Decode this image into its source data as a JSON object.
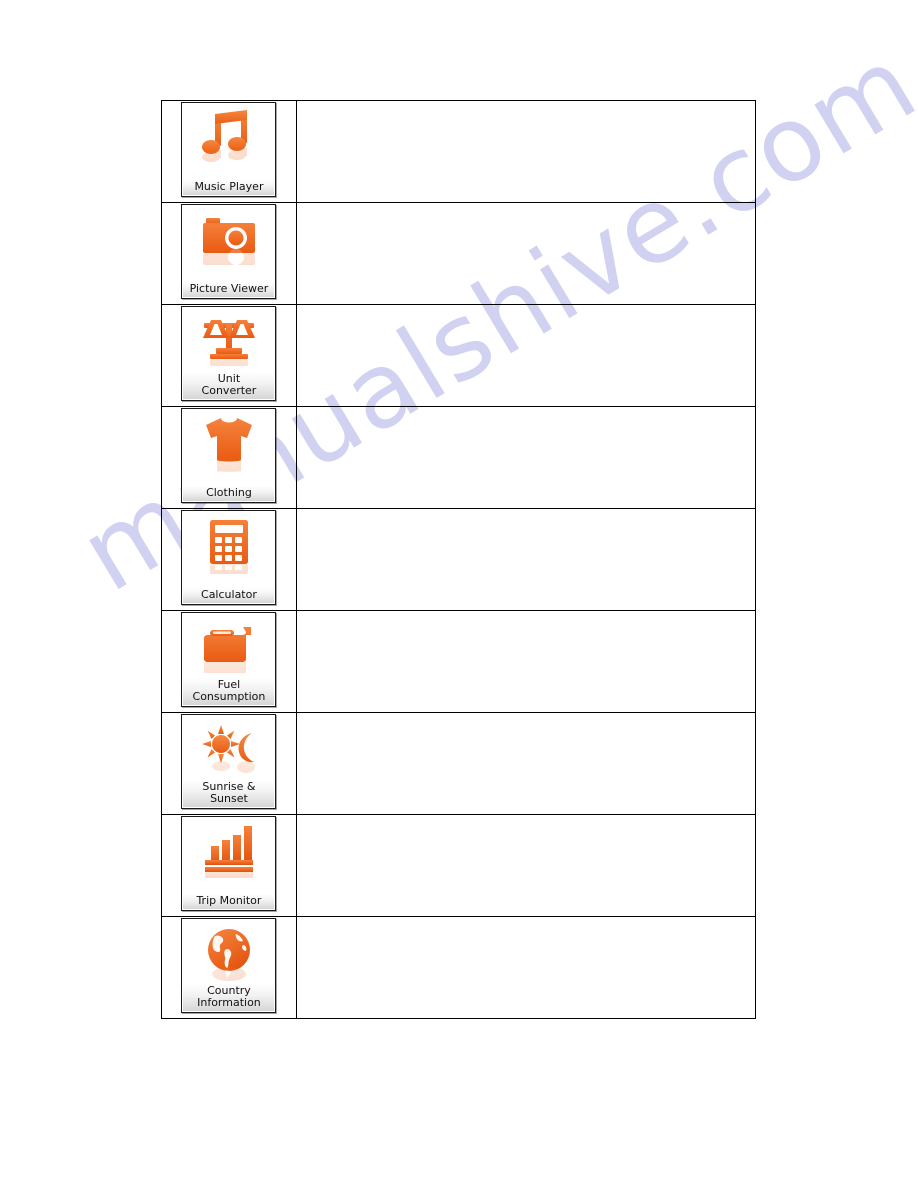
{
  "page": {
    "background_color": "#ffffff",
    "watermark_text": "manualshive.com",
    "watermark_color": "#c9c9ef"
  },
  "table": {
    "border_color": "#000000",
    "columns": [
      "icon",
      "description"
    ],
    "rows": [
      {
        "icon_name": "music-note-icon",
        "label": "Music Player",
        "label_lines": [
          "Music Player"
        ],
        "description": ""
      },
      {
        "icon_name": "camera-icon",
        "label": "Picture Viewer",
        "label_lines": [
          "Picture Viewer"
        ],
        "description": ""
      },
      {
        "icon_name": "balance-scale-icon",
        "label": "Unit Converter",
        "label_lines": [
          "Unit",
          "Converter"
        ],
        "description": ""
      },
      {
        "icon_name": "tshirt-icon",
        "label": "Clothing",
        "label_lines": [
          "Clothing"
        ],
        "description": ""
      },
      {
        "icon_name": "calculator-icon",
        "label": "Calculator",
        "label_lines": [
          "Calculator"
        ],
        "description": ""
      },
      {
        "icon_name": "jerrycan-icon",
        "label": "Fuel Consumption",
        "label_lines": [
          "Fuel",
          "Consumption"
        ],
        "description": ""
      },
      {
        "icon_name": "sun-moon-icon",
        "label": "Sunrise & Sunset",
        "label_lines": [
          "Sunrise &",
          "Sunset"
        ],
        "description": ""
      },
      {
        "icon_name": "bar-chart-icon",
        "label": "Trip Monitor",
        "label_lines": [
          "Trip Monitor"
        ],
        "description": ""
      },
      {
        "icon_name": "globe-icon",
        "label": "Country Information",
        "label_lines": [
          "Country",
          "Information"
        ],
        "description": ""
      }
    ]
  },
  "theme": {
    "icon_orange": "#ef6724",
    "icon_orange_light": "#f7863c",
    "button_border": "#1a1a1a",
    "label_text": "#111111"
  }
}
